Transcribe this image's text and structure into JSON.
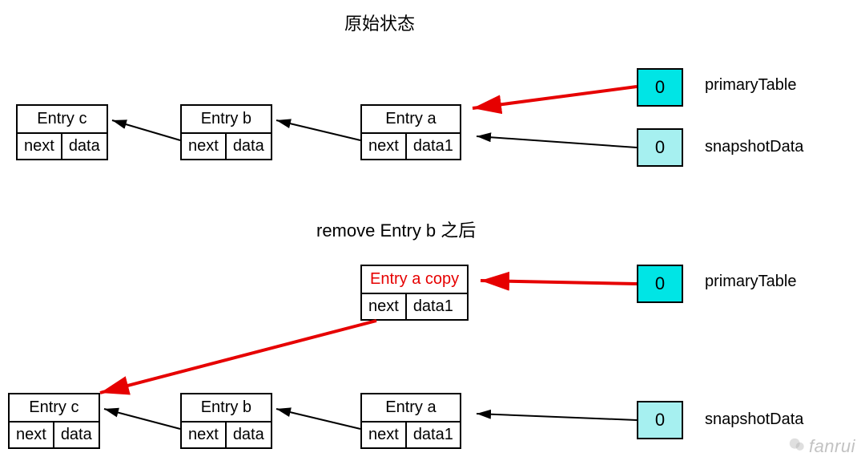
{
  "section1": {
    "title": "原始状态",
    "entries": {
      "c": {
        "name": "Entry c",
        "next": "next",
        "data": "data"
      },
      "b": {
        "name": "Entry b",
        "next": "next",
        "data": "data"
      },
      "a": {
        "name": "Entry a",
        "next": "next",
        "data": "data1"
      }
    },
    "primary": {
      "bucket": "0",
      "label": "primaryTable",
      "color": "#00e5e5"
    },
    "snapshot": {
      "bucket": "0",
      "label": "snapshotData",
      "color": "#a6f0f0"
    }
  },
  "section2": {
    "title": "remove Entry b 之后",
    "entries": {
      "acopy": {
        "name": "Entry a copy",
        "next": "next",
        "data": "data1"
      },
      "c": {
        "name": "Entry c",
        "next": "next",
        "data": "data"
      },
      "b": {
        "name": "Entry b",
        "next": "next",
        "data": "data"
      },
      "a": {
        "name": "Entry a",
        "next": "next",
        "data": "data1"
      }
    },
    "primary": {
      "bucket": "0",
      "label": "primaryTable",
      "color": "#00e5e5"
    },
    "snapshot": {
      "bucket": "0",
      "label": "snapshotData",
      "color": "#a6f0f0"
    }
  },
  "watermark": "fanrui",
  "colors": {
    "red": "#e60000",
    "black": "#000000"
  }
}
